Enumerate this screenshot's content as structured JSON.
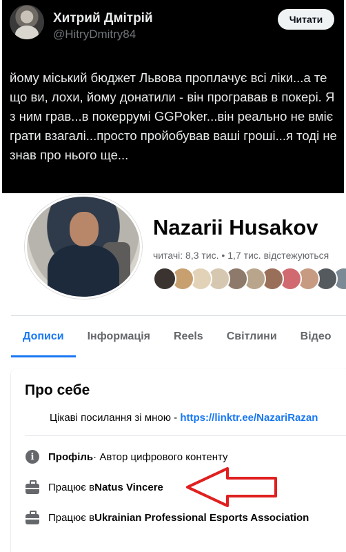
{
  "tweet": {
    "author_name": "Хитрий Дмітрій",
    "author_handle": "@HitryDmitry84",
    "follow_label": "Читати",
    "text": "йому міський бюджет Львова проплачує всі ліки...а те що ви, лохи, йому донатили - він програвав в покері. Я з ним грав...в покеррумі GGPoker...він реально не вміє грати взагалі...просто пройобував ваші гроші...я тоді не знав про нього ще...",
    "colors": {
      "background": "#000000",
      "text": "#e7e9ea",
      "muted": "#71767b"
    }
  },
  "profile": {
    "name": "Nazarii Husakov",
    "followers_label": "читачі:",
    "followers_value": "8,3 тис.",
    "separator": "•",
    "following_value": "1,7 тис.",
    "following_label": "відстежуються",
    "friend_avatar_colors": [
      "#3a3330",
      "#c8a070",
      "#e2d2b8",
      "#d6c7b0",
      "#8e7a6a",
      "#b9a58c",
      "#9a6f5a",
      "#d06a70",
      "#c79a82",
      "#555a5e",
      "#7c8a96"
    ]
  },
  "tabs": [
    {
      "label": "Дописи",
      "active": true
    },
    {
      "label": "Інформація",
      "active": false
    },
    {
      "label": "Reels",
      "active": false
    },
    {
      "label": "Світлини",
      "active": false
    },
    {
      "label": "Відео",
      "active": false
    }
  ],
  "about": {
    "title": "Про себе",
    "links_prefix": "Цікаві посилання зі мною - ",
    "links_url": "https://linktr.ee/NazariRazan",
    "profile_label": "Профіль",
    "profile_value": " · Автор цифрового контенту",
    "work_prefix": "Працює в ",
    "work_1": "Natus Vincere",
    "work_2": "Ukrainian Professional Esports Association"
  },
  "annotation": {
    "arrow_color": "#e02020"
  },
  "colors": {
    "accent": "#1877f2",
    "muted": "#65676b"
  }
}
